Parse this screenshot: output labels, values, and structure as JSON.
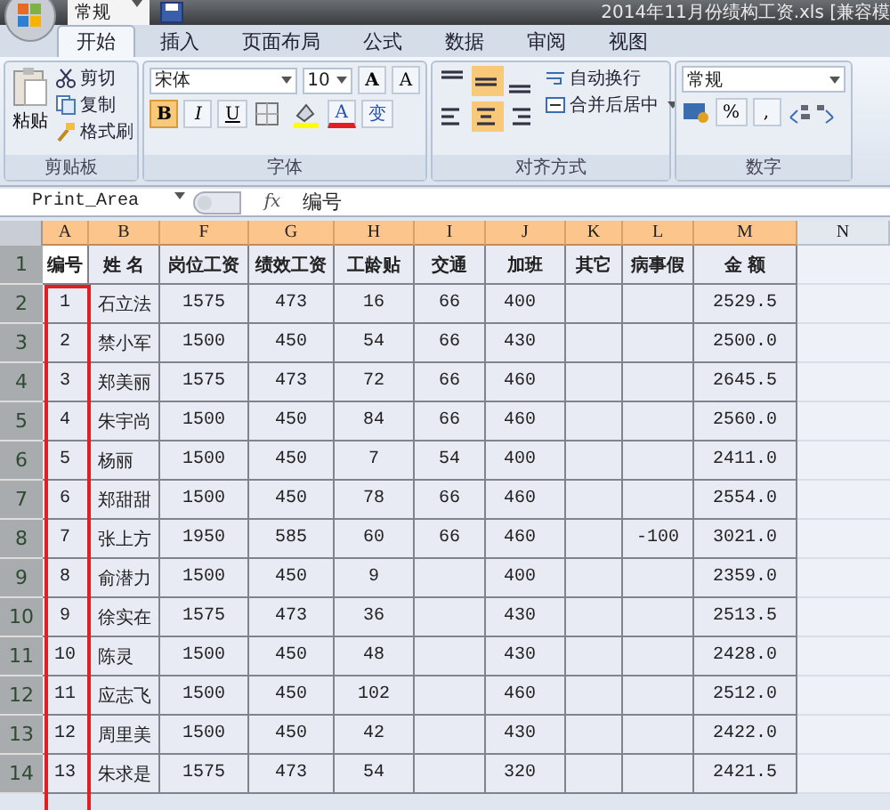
{
  "title_bar": {
    "style_box": "常规",
    "title": "2014年11月份绩构工资.xls  [兼容模"
  },
  "tabs": [
    {
      "label": "开始",
      "selected": true
    },
    {
      "label": "插入",
      "selected": false
    },
    {
      "label": "页面布局",
      "selected": false
    },
    {
      "label": "公式",
      "selected": false
    },
    {
      "label": "数据",
      "selected": false
    },
    {
      "label": "审阅",
      "selected": false
    },
    {
      "label": "视图",
      "selected": false
    }
  ],
  "ribbon": {
    "clipboard": {
      "label": "剪贴板",
      "paste": "粘贴",
      "cut": "剪切",
      "copy": "复制",
      "format_painter": "格式刷"
    },
    "font": {
      "label": "字体",
      "name": "宋体",
      "size": "10",
      "grow": "A",
      "shrink": "A",
      "styles": [
        {
          "label": "B",
          "kind": "bold",
          "selected": true
        },
        {
          "label": "I",
          "kind": "italic",
          "selected": false
        },
        {
          "label": "U",
          "kind": "underline",
          "selected": false
        }
      ],
      "font_color": "A",
      "phonetic": "变"
    },
    "alignment": {
      "label": "对齐方式",
      "wrap": "自动换行",
      "merge": "合并后居中",
      "buttons": [
        {
          "kind": "top",
          "selected": false
        },
        {
          "kind": "middle",
          "selected": true
        },
        {
          "kind": "bottom",
          "selected": false
        },
        {
          "kind": "left",
          "selected": false
        },
        {
          "kind": "center",
          "selected": true
        },
        {
          "kind": "right",
          "selected": false
        }
      ]
    },
    "number": {
      "label": "数字",
      "format": "常规",
      "percent": "%",
      "comma": ","
    }
  },
  "formula_bar": {
    "name_box": "Print_Area",
    "fx": "fx",
    "value": "编号"
  },
  "columns": [
    {
      "letter": "A",
      "selected": true
    },
    {
      "letter": "B",
      "selected": true
    },
    {
      "letter": "F",
      "selected": true
    },
    {
      "letter": "G",
      "selected": true
    },
    {
      "letter": "H",
      "selected": true
    },
    {
      "letter": "I",
      "selected": true
    },
    {
      "letter": "J",
      "selected": true
    },
    {
      "letter": "K",
      "selected": true
    },
    {
      "letter": "L",
      "selected": true
    },
    {
      "letter": "M",
      "selected": true
    },
    {
      "letter": "N",
      "selected": false
    }
  ],
  "header_row": {
    "row_number": "1",
    "cells": [
      "编号",
      "姓 名",
      "岗位工资",
      "绩效工资",
      "工龄贴",
      "交通",
      "加班",
      "其它",
      "病事假",
      "金 额"
    ]
  },
  "rows": [
    {
      "row_number": "2",
      "id": "1",
      "name": "石立法",
      "post_wage": "1575",
      "performance_wage": "473",
      "seniority_pay": "16",
      "transport": "66",
      "overtime": "400",
      "amount": "2529.5"
    },
    {
      "row_number": "3",
      "id": "2",
      "name": "禁小军",
      "post_wage": "1500",
      "performance_wage": "450",
      "seniority_pay": "54",
      "transport": "66",
      "overtime": "430",
      "amount": "2500.0"
    },
    {
      "row_number": "4",
      "id": "3",
      "name": "郑美丽",
      "post_wage": "1575",
      "performance_wage": "473",
      "seniority_pay": "72",
      "transport": "66",
      "overtime": "460",
      "amount": "2645.5"
    },
    {
      "row_number": "5",
      "id": "4",
      "name": "朱宇尚",
      "post_wage": "1500",
      "performance_wage": "450",
      "seniority_pay": "84",
      "transport": "66",
      "overtime": "460",
      "amount": "2560.0"
    },
    {
      "row_number": "6",
      "id": "5",
      "name": "杨丽",
      "post_wage": "1500",
      "performance_wage": "450",
      "seniority_pay": "7",
      "transport": "54",
      "overtime": "400",
      "amount": "2411.0"
    },
    {
      "row_number": "7",
      "id": "6",
      "name": "郑甜甜",
      "post_wage": "1500",
      "performance_wage": "450",
      "seniority_pay": "78",
      "transport": "66",
      "overtime": "460",
      "amount": "2554.0"
    },
    {
      "row_number": "8",
      "id": "7",
      "name": "张上方",
      "post_wage": "1950",
      "performance_wage": "585",
      "seniority_pay": "60",
      "transport": "66",
      "overtime": "460",
      "sick_leave": "-100",
      "amount": "3021.0"
    },
    {
      "row_number": "9",
      "id": "8",
      "name": "俞潜力",
      "post_wage": "1500",
      "performance_wage": "450",
      "seniority_pay": "9",
      "overtime": "400",
      "amount": "2359.0"
    },
    {
      "row_number": "10",
      "id": "9",
      "name": "徐实在",
      "post_wage": "1575",
      "performance_wage": "473",
      "seniority_pay": "36",
      "overtime": "430",
      "amount": "2513.5"
    },
    {
      "row_number": "11",
      "id": "10",
      "name": "陈灵",
      "post_wage": "1500",
      "performance_wage": "450",
      "seniority_pay": "48",
      "overtime": "430",
      "amount": "2428.0"
    },
    {
      "row_number": "12",
      "id": "11",
      "name": "应志飞",
      "post_wage": "1500",
      "performance_wage": "450",
      "seniority_pay": "102",
      "overtime": "460",
      "amount": "2512.0"
    },
    {
      "row_number": "13",
      "id": "12",
      "name": "周里美",
      "post_wage": "1500",
      "performance_wage": "450",
      "seniority_pay": "42",
      "overtime": "430",
      "amount": "2422.0"
    },
    {
      "row_number": "14",
      "id": "13",
      "name": "朱求是",
      "post_wage": "1575",
      "performance_wage": "473",
      "seniority_pay": "54",
      "overtime": "320",
      "amount": "2421.5"
    }
  ]
}
